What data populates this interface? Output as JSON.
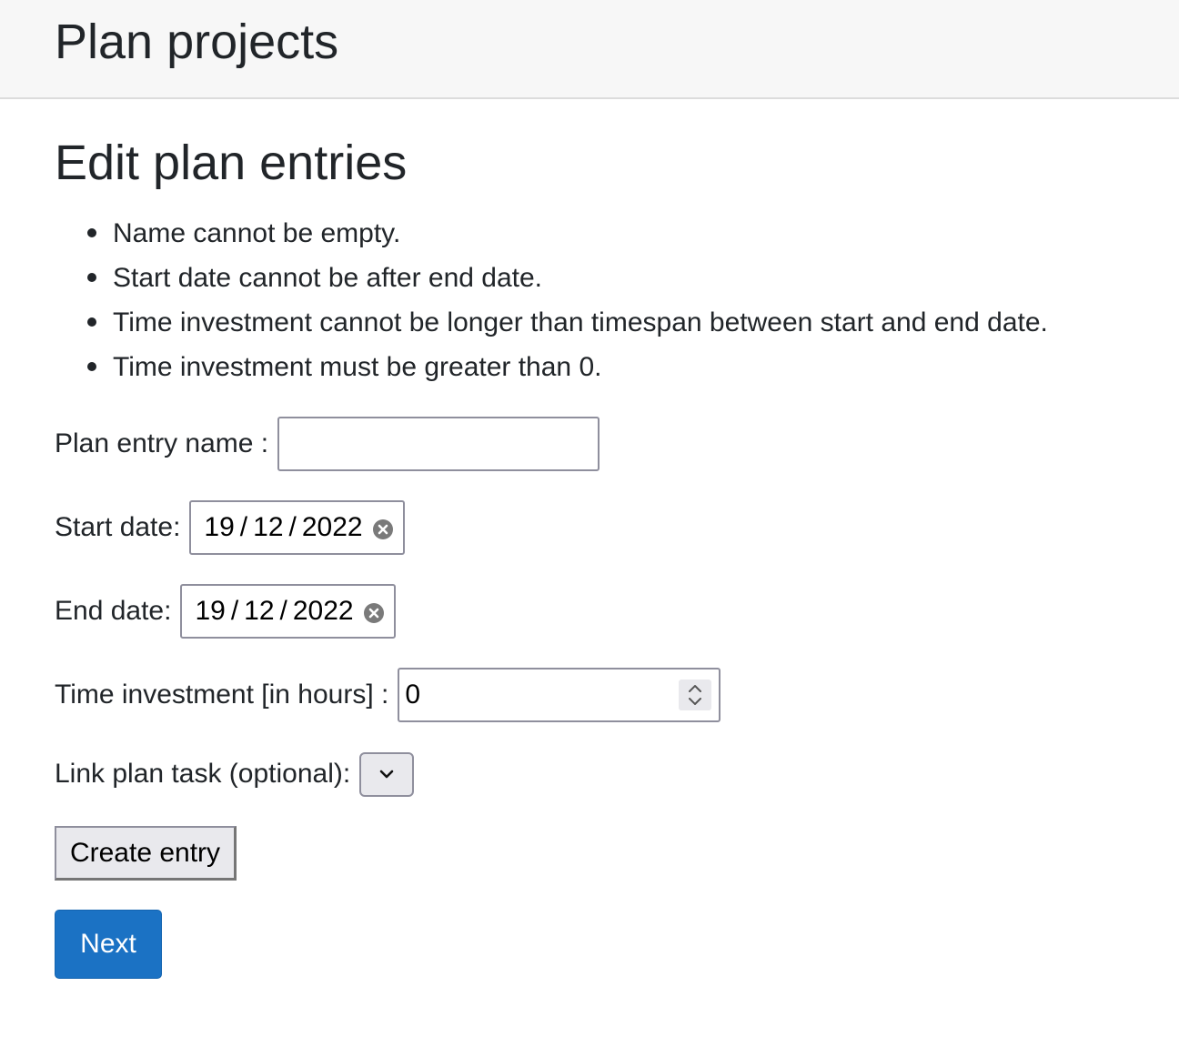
{
  "app": {
    "title": "Plan projects"
  },
  "page": {
    "heading": "Edit plan entries"
  },
  "errors": [
    "Name cannot be empty.",
    "Start date cannot be after end date.",
    "Time investment cannot be longer than timespan between start and end date.",
    "Time investment must be greater than 0."
  ],
  "form": {
    "name_label": "Plan entry name :",
    "name_value": "",
    "start_label": "Start date:",
    "start_date": {
      "day": "19",
      "month": "12",
      "year": "2022",
      "sep": "/"
    },
    "end_label": "End date:",
    "end_date": {
      "day": "19",
      "month": "12",
      "year": "2022",
      "sep": "/"
    },
    "time_label": "Time investment [in hours] :",
    "time_value": "0",
    "task_label": "Link plan task (optional):",
    "task_selected": "",
    "create_button": "Create entry",
    "next_button": "Next"
  },
  "colors": {
    "header_bg": "#f7f7f7",
    "next_button_bg": "#1b72c4",
    "button_bg": "#e9e9ed",
    "input_border": "#8f8f9d"
  },
  "icons": {
    "start_clear": "clear-circle-icon",
    "end_clear": "clear-circle-icon",
    "spinner": "spinner-updown-icon",
    "select": "chevron-down-icon"
  }
}
